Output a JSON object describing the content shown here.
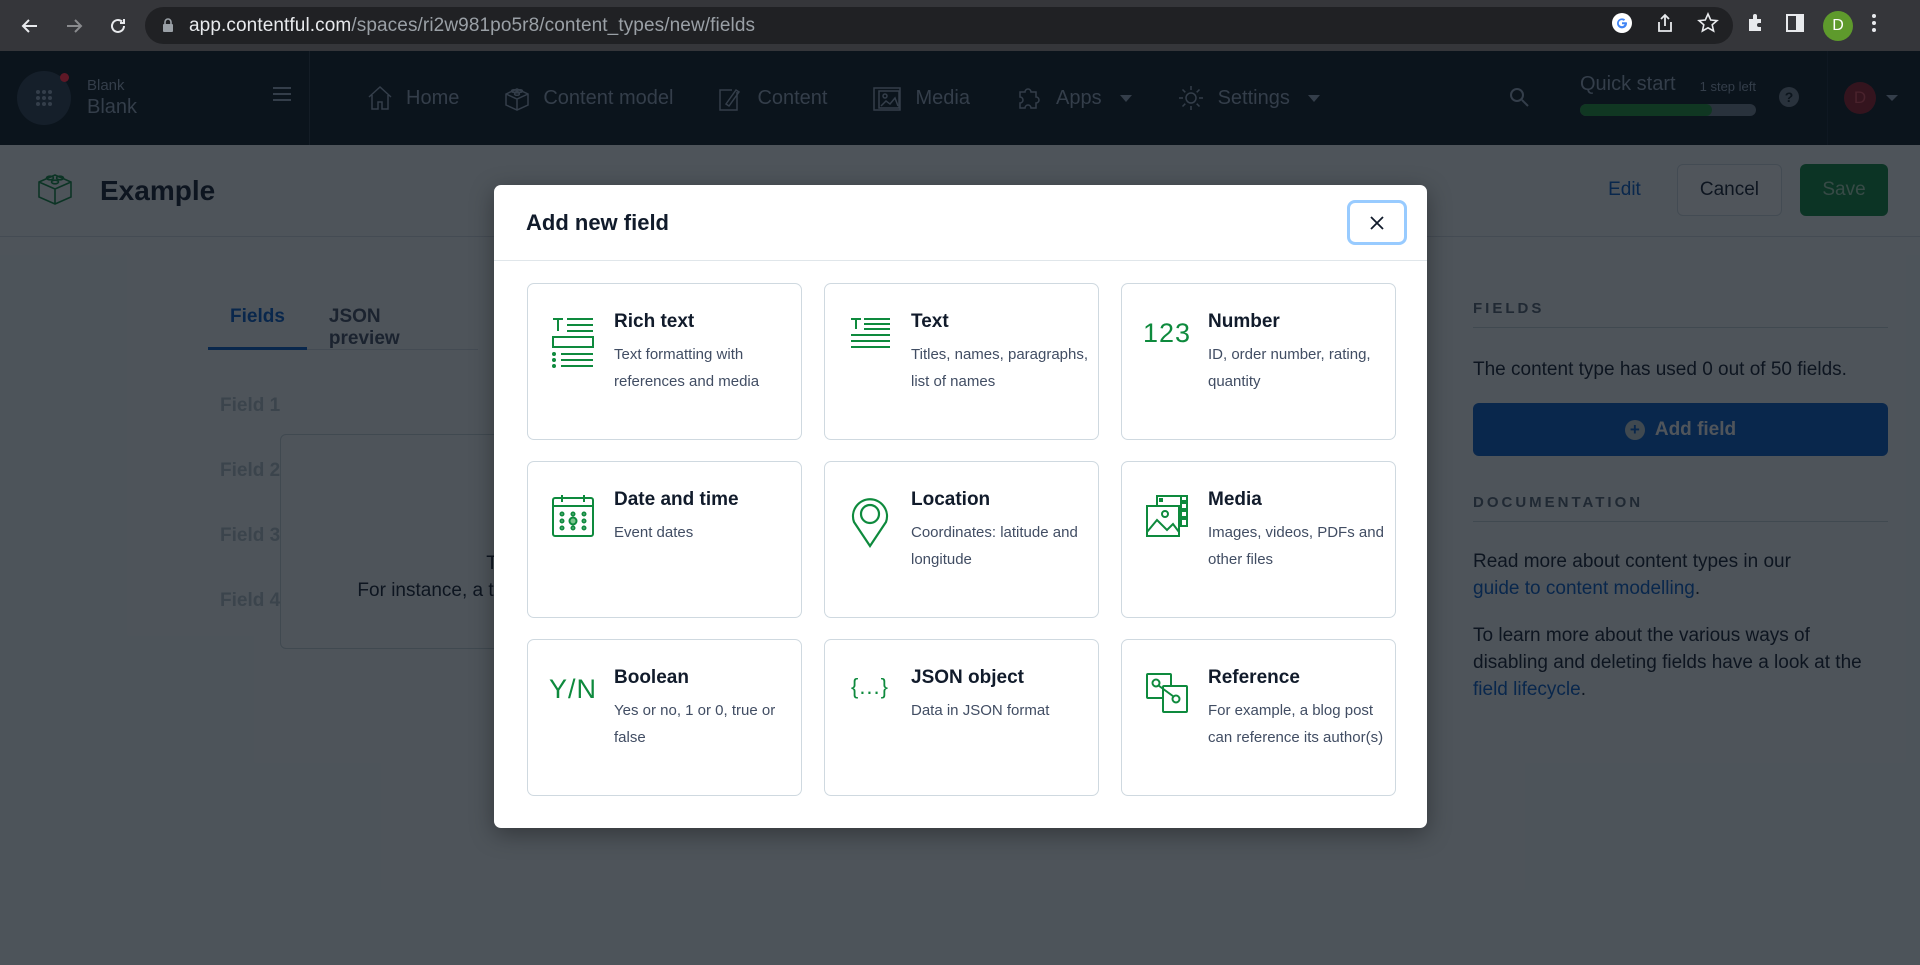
{
  "browser": {
    "url_host": "app.contentful.com",
    "url_path": "/spaces/ri2w981po5r8/content_types/new/fields",
    "profile_initial": "D"
  },
  "nav": {
    "org_name": "Blank",
    "env_name": "Blank",
    "items": [
      {
        "label": "Home",
        "icon": "home-icon"
      },
      {
        "label": "Content model",
        "icon": "content-model-icon"
      },
      {
        "label": "Content",
        "icon": "content-icon"
      },
      {
        "label": "Media",
        "icon": "media-icon"
      },
      {
        "label": "Apps",
        "icon": "apps-icon",
        "dropdown": true
      },
      {
        "label": "Settings",
        "icon": "settings-icon",
        "dropdown": true
      }
    ],
    "quick_start": {
      "label": "Quick start",
      "steps_left": "1 step left",
      "progress_percent": 75
    },
    "user_initial": "D"
  },
  "header": {
    "title": "Example",
    "edit_label": "Edit",
    "cancel_label": "Cancel",
    "save_label": "Save"
  },
  "main": {
    "tabs": [
      {
        "label": "Fields",
        "active": true
      },
      {
        "label": "JSON preview",
        "active": false
      }
    ],
    "field_placeholders": [
      "Field 1",
      "Field 2",
      "Field 3",
      "Field 4"
    ],
    "empty_text_line1": "The",
    "empty_text_line2": "For instance, a text"
  },
  "sidebar": {
    "fields_heading": "FIELDS",
    "fields_usage": "The content type has used 0 out of 50 fields.",
    "add_field_label": "Add field",
    "docs_heading": "DOCUMENTATION",
    "docs_text1": "Read more about content types in our",
    "docs_link1": "guide to content modelling",
    "docs_text2": "To learn more about the various ways of disabling and deleting fields have a look at the",
    "docs_link2": "field lifecycle",
    "period": "."
  },
  "modal": {
    "title": "Add new field",
    "close_label": "Close",
    "field_types": [
      {
        "title": "Rich text",
        "description": "Text formatting with references and media",
        "icon": "rich-text-icon"
      },
      {
        "title": "Text",
        "description": "Titles, names, paragraphs, list of names",
        "icon": "text-icon"
      },
      {
        "title": "Number",
        "description": "ID, order number, rating, quantity",
        "icon": "number-icon",
        "glyph": "123"
      },
      {
        "title": "Date and time",
        "description": "Event dates",
        "icon": "calendar-icon"
      },
      {
        "title": "Location",
        "description": "Coordinates: latitude and longitude",
        "icon": "location-pin-icon"
      },
      {
        "title": "Media",
        "description": "Images, videos, PDFs and other files",
        "icon": "media-icon"
      },
      {
        "title": "Boolean",
        "description": "Yes or no, 1 or 0, true or false",
        "icon": "boolean-icon",
        "glyph": "Y/N"
      },
      {
        "title": "JSON object",
        "description": "Data in JSON format",
        "icon": "json-icon",
        "glyph": "{...}"
      },
      {
        "title": "Reference",
        "description": "For example, a blog post can reference its author(s)",
        "icon": "reference-icon"
      }
    ]
  },
  "colors": {
    "accent_green": "#0e8a3d",
    "primary_blue": "#0059c8",
    "nav_bg": "#0c141c",
    "focus_ring": "#98cbff"
  }
}
